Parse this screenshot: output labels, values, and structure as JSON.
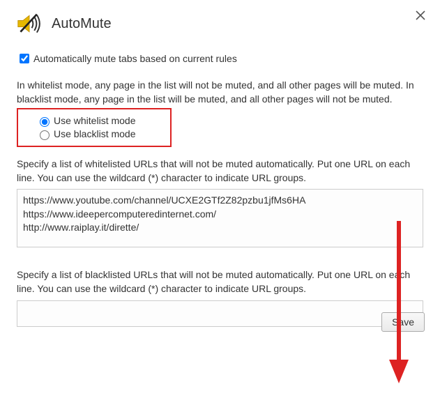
{
  "app": {
    "title": "AutoMute"
  },
  "autoMuteCheckbox": {
    "label": "Automatically mute tabs based on current rules",
    "checked": true
  },
  "modeDescription": "In whitelist mode, any page in the list will not be muted, and all other pages will be muted. In blacklist mode, any page in the list will be muted, and all other pages will not be muted.",
  "modes": {
    "whitelist": {
      "label": "Use whitelist mode",
      "selected": true
    },
    "blacklist": {
      "label": "Use blacklist mode",
      "selected": false
    }
  },
  "whitelist": {
    "description": "Specify a list of whitelisted URLs that will not be muted automatically. Put one URL on each line. You can use the wildcard (*) character to indicate URL groups.",
    "value": "https://www.youtube.com/channel/UCXE2GTf2Z82pzbu1jfMs6HA\nhttps://www.ideepercomputeredinternet.com/\nhttp://www.raiplay.it/dirette/"
  },
  "blacklist": {
    "description": "Specify a list of blacklisted URLs that will not be muted automatically. Put one URL on each line. You can use the wildcard (*) character to indicate URL groups.",
    "value": ""
  },
  "buttons": {
    "save": "Save"
  },
  "annotation": {
    "highlight_box_around_modes": true,
    "arrow_pointing_to_save": true
  }
}
